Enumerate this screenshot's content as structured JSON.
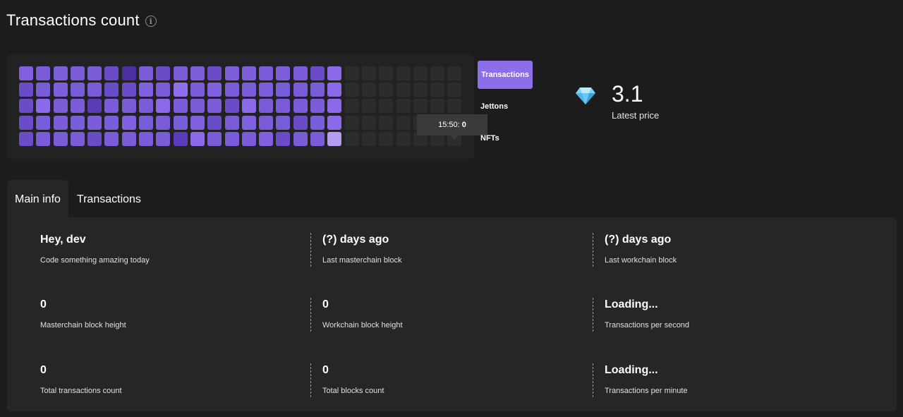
{
  "header": {
    "title": "Transactions count"
  },
  "heatmap": {
    "columns": 26,
    "rows": 5,
    "cells": [
      [
        "#8060e0",
        "#7a5cd8",
        "#7d5fdc",
        "#7a5cd8",
        "#7a5cd8",
        "#6a4cc8",
        "#4a2fa0",
        "#7a5cd8",
        "#6a4cc8",
        "#7a5cd8",
        "#7d5fdc",
        "#6a4cc8",
        "#7d5fdc",
        "#7d5fdc",
        "#7a5cd8",
        "#7d5fdc",
        "#7a5cd8",
        "#6a4cc8",
        "#8a6ae8",
        "",
        "",
        "",
        "",
        "",
        "",
        ""
      ],
      [
        "#6a4cc8",
        "#7a5cd8",
        "#7d5fdc",
        "#7a5cd8",
        "#7a5cd8",
        "#6a4cc8",
        "#6a4cc8",
        "#8060e0",
        "#7a5cd8",
        "#9070e8",
        "#7a5cd8",
        "#8060e0",
        "#7a5cd8",
        "#7a5cd8",
        "#7d5fdc",
        "#7a5cd8",
        "#7a5cd8",
        "#7a5cd8",
        "#8a6ae8",
        "",
        "",
        "",
        "",
        "",
        "",
        ""
      ],
      [
        "#6a4cc8",
        "#8a6ae8",
        "#7a5cd8",
        "#7a5cd8",
        "#5a3cb8",
        "#7a5cd8",
        "#7a5cd8",
        "#7a5cd8",
        "#8a6ae8",
        "#7a5cd8",
        "#7a5cd8",
        "#7a5cd8",
        "#6a4cc8",
        "#8a6ae8",
        "#7a5cd8",
        "#7a5cd8",
        "#7a5cd8",
        "#7a5cd8",
        "#8a6ae8",
        "",
        "",
        "",
        "",
        "",
        "",
        ""
      ],
      [
        "#6a4cc8",
        "#7a5cd8",
        "#7a5cd8",
        "#7a5cd8",
        "#7a5cd8",
        "#7a5cd8",
        "#8060e0",
        "#7a5cd8",
        "#7a5cd8",
        "#7a5cd8",
        "#8060e0",
        "#6a4cc8",
        "#7a5cd8",
        "#8060e0",
        "#7a5cd8",
        "#7a5cd8",
        "#6a4cc8",
        "#7a5cd8",
        "#8a6ae8",
        "",
        "",
        "",
        "",
        "",
        "",
        ""
      ],
      [
        "#6a4cc8",
        "#7a5cd8",
        "#7a5cd8",
        "#7a5cd8",
        "#6a4cc8",
        "#7a5cd8",
        "#7a5cd8",
        "#7a5cd8",
        "#7a5cd8",
        "#5a3cb8",
        "#8a6ae8",
        "#7a5cd8",
        "#7a5cd8",
        "#7a5cd8",
        "#8060e0",
        "#6a4cc8",
        "#7a5cd8",
        "#7a5cd8",
        "#b49cf0",
        "",
        "",
        "",
        "",
        "",
        "",
        ""
      ]
    ],
    "empty_color": "#2c2c2c",
    "tooltip": {
      "time": "15:50:",
      "value": "0"
    }
  },
  "type_switch": {
    "items": [
      {
        "label": "Transactions",
        "active": true
      },
      {
        "label": "Jettons",
        "active": false
      },
      {
        "label": "NFTs",
        "active": false
      }
    ]
  },
  "price": {
    "value": "3.1",
    "label": "Latest price",
    "icon": "diamond-icon"
  },
  "tabs": [
    {
      "label": "Main info",
      "active": true
    },
    {
      "label": "Transactions",
      "active": false
    }
  ],
  "stats": [
    {
      "value": "Hey, dev",
      "label": "Code something amazing today"
    },
    {
      "value": "(?) days ago",
      "label": "Last masterchain block"
    },
    {
      "value": "(?) days ago",
      "label": "Last workchain block"
    },
    {
      "value": "0",
      "label": "Masterchain block height"
    },
    {
      "value": "0",
      "label": "Workchain block height"
    },
    {
      "value": "Loading...",
      "label": "Transactions per second"
    },
    {
      "value": "0",
      "label": "Total transactions count"
    },
    {
      "value": "0",
      "label": "Total blocks count"
    },
    {
      "value": "Loading...",
      "label": "Transactions per minute"
    }
  ],
  "colors": {
    "background": "#1c1c1c",
    "panel": "#262626",
    "accent": "#8b6ee8"
  }
}
